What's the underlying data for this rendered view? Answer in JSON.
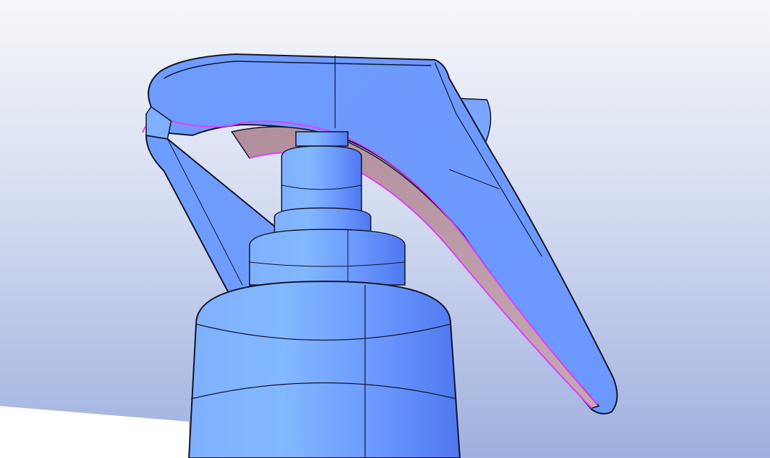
{
  "scene": {
    "subject": "trigger-spray-nozzle-cad-model",
    "colors": {
      "background_top": "#f6f7f9",
      "background_bottom": "#9fb0de",
      "ground_plane": "#ffffff",
      "body_light": "#84b4ff",
      "body_mid": "#6f9dff",
      "body_dark": "#5b84f5",
      "trigger_inner": "#b4939f",
      "edge_line": "#101428",
      "highlight_edge": "#e040ff"
    }
  }
}
